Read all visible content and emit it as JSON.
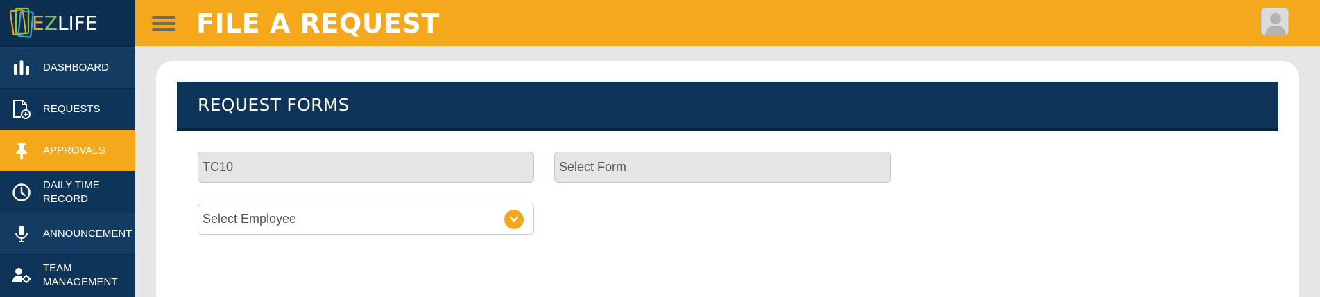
{
  "brand": {
    "logo_text_e": "E",
    "logo_text_z": "Z",
    "logo_text_life": "LIFE"
  },
  "header": {
    "title": "FILE A REQUEST"
  },
  "sidebar": {
    "items": [
      {
        "label": "DASHBOARD",
        "icon": "bar-chart-icon"
      },
      {
        "label": "REQUESTS",
        "icon": "document-add-icon"
      },
      {
        "label": "APPROVALS",
        "icon": "pin-icon"
      },
      {
        "label_line1": "DAILY TIME",
        "label_line2": "RECORD",
        "icon": "clock-icon"
      },
      {
        "label": "ANNOUNCEMENT",
        "icon": "microphone-icon"
      },
      {
        "label_line1": "TEAM",
        "label_line2": "MANAGEMENT",
        "icon": "user-gear-icon"
      }
    ]
  },
  "panel": {
    "title": "REQUEST FORMS"
  },
  "form": {
    "company_value": "TC10",
    "form_select_value": "Select Form",
    "employee_select_value": "Select Employee"
  },
  "colors": {
    "accent": "#f5a81c",
    "navy": "#0f3459",
    "sidebar_alt": "#143c63"
  }
}
